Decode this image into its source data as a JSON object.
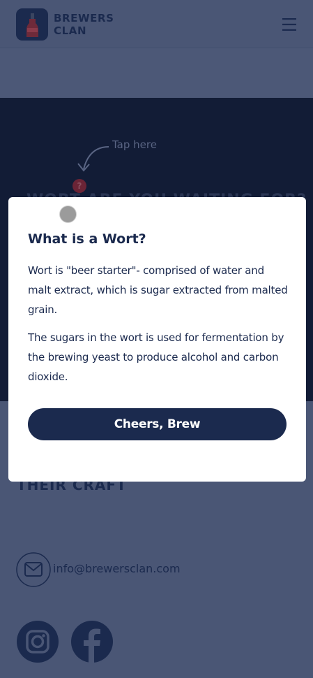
{
  "header": {
    "brand_line1": "BREWERS",
    "brand_line2": "CLAN",
    "menu_icon": "hamburger-menu-icon"
  },
  "hero": {
    "tap_hint": "Tap here",
    "help_icon": "question-mark-icon",
    "help_mark": "?",
    "heading": "WORT ARE YOU WAITING FOR?"
  },
  "footer": {
    "craft_text": "THEIR CRAFT",
    "email": "info@brewersclan.com",
    "social_icons": [
      "instagram-icon",
      "facebook-icon"
    ]
  },
  "modal": {
    "title": "What is a Wort?",
    "paragraph1": "Wort is \"beer starter\"- comprised of water and malt extract, which is sugar extracted from malted grain.",
    "paragraph2": "The sugars in the wort is used for fermentation by the brewing yeast to produce alcohol and carbon dioxide.",
    "button_label": "Cheers, Brew"
  },
  "colors": {
    "navy": "#1b2a4e",
    "overlay": "#4a5675",
    "modal_bg": "#ffffff",
    "knob": "#9b9b9b"
  }
}
